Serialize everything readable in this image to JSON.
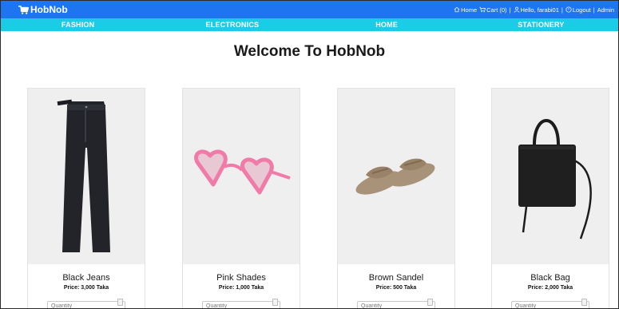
{
  "brand": {
    "name": "HobNob",
    "icon": "cart-icon"
  },
  "user_nav": {
    "home": "Home",
    "cart": "Cart (0)",
    "greeting": "Hello, farabi01",
    "logout": "Logout",
    "admin": "Admin",
    "separator": "|"
  },
  "categories": [
    "FASHION",
    "ELECTRONICS",
    "HOME",
    "STATIONERY"
  ],
  "page_title": "Welcome To HobNob",
  "products": [
    {
      "name": "Black Jeans",
      "price": "Price: 3,000 Taka",
      "quantity_placeholder": "Quantity"
    },
    {
      "name": "Pink Shades",
      "price": "Price: 1,000 Taka",
      "quantity_placeholder": "Quantity"
    },
    {
      "name": "Brown Sandel",
      "price": "Price: 500 Taka",
      "quantity_placeholder": "Quantity"
    },
    {
      "name": "Black Bag",
      "price": "Price: 2,000 Taka",
      "quantity_placeholder": "Quantity"
    }
  ],
  "colors": {
    "topbar": "#1f75f0",
    "catbar": "#1ccbe6",
    "card_photo_bg": "#efefef"
  }
}
